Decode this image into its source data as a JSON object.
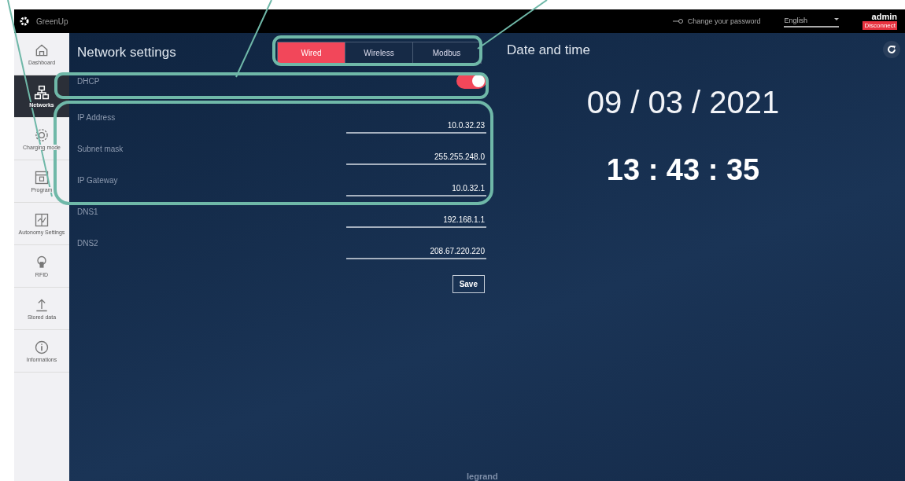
{
  "header": {
    "brand": "GreenUp",
    "change_password": "Change your password",
    "language": "English",
    "user": "admin",
    "disconnect": "Disconnect"
  },
  "sidebar": {
    "items": [
      {
        "label": "Dashboard",
        "kind": "home",
        "selected": false
      },
      {
        "label": "Networks",
        "kind": "network",
        "selected": true
      },
      {
        "label": "Charging mode",
        "kind": "gear",
        "selected": false
      },
      {
        "label": "Program",
        "kind": "calendar",
        "selected": false
      },
      {
        "label": "Autonomy Settings",
        "kind": "chart",
        "selected": false
      },
      {
        "label": "RFID",
        "kind": "bulb",
        "selected": false
      },
      {
        "label": "Stored data",
        "kind": "upload",
        "selected": false
      },
      {
        "label": "Informations",
        "kind": "info",
        "selected": false
      }
    ]
  },
  "network": {
    "title": "Network settings",
    "tabs": [
      {
        "label": "Wired",
        "selected": true
      },
      {
        "label": "Wireless",
        "selected": false
      },
      {
        "label": "Modbus",
        "selected": false
      }
    ],
    "dhcp": {
      "label": "DHCP",
      "on": true
    },
    "fields": [
      {
        "label": "IP Address",
        "value": "10.0.32.23"
      },
      {
        "label": "Subnet mask",
        "value": "255.255.248.0"
      },
      {
        "label": "IP Gateway",
        "value": "10.0.32.1"
      },
      {
        "label": "DNS1",
        "value": "192.168.1.1"
      },
      {
        "label": "DNS2",
        "value": "208.67.220.220"
      }
    ],
    "save": "Save"
  },
  "datetime": {
    "title": "Date and time",
    "date": "09 / 03 / 2021",
    "time": "13 : 43 : 35"
  },
  "footer": "legrand"
}
